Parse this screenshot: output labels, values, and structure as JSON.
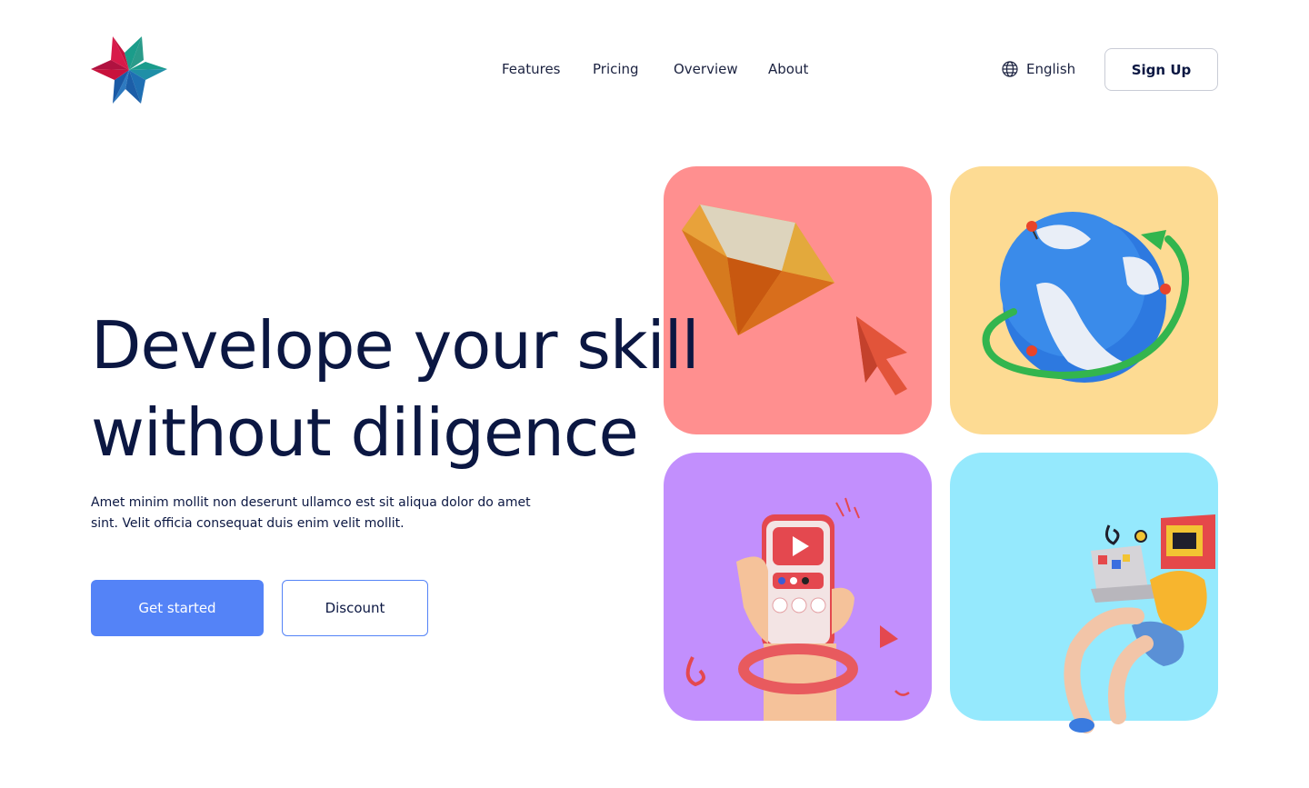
{
  "header": {
    "logo_icon": "pinwheel-star-logo",
    "nav": [
      {
        "label": "Features"
      },
      {
        "label": "Pricing"
      },
      {
        "label": "Overview"
      },
      {
        "label": "About"
      }
    ],
    "language": {
      "label": "English",
      "icon": "globe-icon"
    },
    "signup_label": "Sign Up"
  },
  "hero": {
    "headline_line1": "Develope your skill",
    "headline_line2": "without diligence",
    "description": "Amet minim mollit non deserunt ullamco est sit aliqua dolor do amet sint. Velit officia consequat duis enim velit mollit.",
    "primary_button": "Get started",
    "secondary_button": "Discount"
  },
  "tiles": [
    {
      "illustration": "diamond-cursor-illustration",
      "color": "#ff8f8f"
    },
    {
      "illustration": "globe-orbit-illustration",
      "color": "#fddb93"
    },
    {
      "illustration": "phone-video-illustration",
      "color": "#c28ffd"
    },
    {
      "illustration": "person-laptop-illustration",
      "color": "#95e9fd"
    }
  ],
  "colors": {
    "primary": "#5483f7",
    "text": "#0b1742"
  }
}
